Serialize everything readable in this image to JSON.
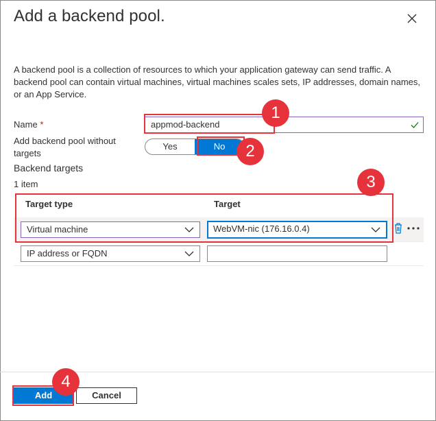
{
  "dialog": {
    "title": "Add a backend pool.",
    "close_icon": "close-icon",
    "description": "A backend pool is a collection of resources to which your application gateway can send traffic. A backend pool can contain virtual machines, virtual machines scales sets, IP addresses, domain names, or an App Service."
  },
  "form": {
    "name_label": "Name",
    "name_required": "*",
    "name_value": "appmod-backend",
    "without_targets_label": "Add backend pool without targets",
    "toggle": {
      "yes": "Yes",
      "no": "No",
      "selected": "No"
    },
    "backend_targets_label": "Backend targets",
    "items_count": "1 item"
  },
  "table": {
    "columns": [
      "Target type",
      "Target"
    ],
    "rows": [
      {
        "target_type": "Virtual machine",
        "target": "WebVM-nic (176.16.0.4)"
      },
      {
        "target_type": "IP address or FQDN",
        "target": ""
      }
    ]
  },
  "footer": {
    "add_label": "Add",
    "cancel_label": "Cancel"
  },
  "annotations": {
    "badges": [
      "1",
      "2",
      "3",
      "4"
    ],
    "color": "#e5323b"
  },
  "colors": {
    "accent": "#0078d4",
    "focus_purple": "#8764b8",
    "valid_green": "#107c10"
  }
}
